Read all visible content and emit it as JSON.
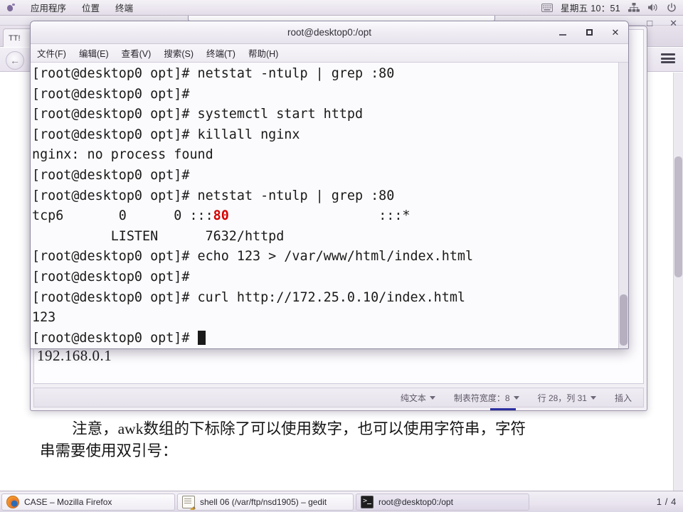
{
  "top_panel": {
    "menu": [
      {
        "label": "应用程序",
        "name": "applications-menu"
      },
      {
        "label": "位置",
        "name": "places-menu"
      },
      {
        "label": "终端",
        "name": "terminal-menu"
      }
    ],
    "clock": "星期五 10：51",
    "icons": [
      "keyboard-icon",
      "network-icon",
      "volume-icon",
      "power-icon"
    ]
  },
  "firefox": {
    "tab_label": "TT!",
    "url_value": "",
    "window_buttons": [
      "□",
      "✕"
    ]
  },
  "terminal": {
    "title": "root@desktop0:/opt",
    "menu": [
      {
        "label": "文件(F)",
        "name": "file-menu"
      },
      {
        "label": "编辑(E)",
        "name": "edit-menu"
      },
      {
        "label": "查看(V)",
        "name": "view-menu"
      },
      {
        "label": "搜索(S)",
        "name": "search-menu"
      },
      {
        "label": "终端(T)",
        "name": "terminal-menu"
      },
      {
        "label": "帮助(H)",
        "name": "help-menu"
      }
    ],
    "window_buttons": {
      "minimize": "－",
      "maximize": "□",
      "close": "✕"
    },
    "lines": [
      "[root@desktop0 opt]# netstat -ntulp | grep :80",
      "[root@desktop0 opt]#",
      "[root@desktop0 opt]# systemctl start httpd",
      "[root@desktop0 opt]# killall nginx",
      "nginx: no process found",
      "[root@desktop0 opt]#",
      "[root@desktop0 opt]# netstat -ntulp | grep :80",
      "tcp6       0      0 :::80                   :::*",
      "          LISTEN      7632/httpd",
      "[root@desktop0 opt]# echo 123 > /var/www/html/index.html",
      "[root@desktop0 opt]#",
      "[root@desktop0 opt]# curl http://172.25.0.10/index.html",
      "123",
      "[root@desktop0 opt]# "
    ],
    "netstat_row": {
      "proto": "tcp6",
      "recv_q": "0",
      "send_q": "0",
      "local_address_prefix": ":::",
      "local_address_port": "80",
      "foreign_address": ":::*",
      "state": "LISTEN",
      "pid_program": "7632/httpd"
    },
    "highlight_color": "#d40000",
    "prompt": "[root@desktop0 opt]#"
  },
  "gedit": {
    "document_text": "192.168.0.1",
    "statusbar": {
      "file_type": "纯文本",
      "tab_width": "制表符宽度：8",
      "position": "行 28，列 31",
      "insert_mode": "插入"
    }
  },
  "page_text": {
    "line1": "注意，awk数组的下标除了可以使用数字，也可以使用字符串，字符",
    "line2": "串需要使用双引号："
  },
  "taskbar": {
    "items": [
      {
        "label": "CASE – Mozilla Firefox",
        "icon": "firefox-icon",
        "name": "taskbar-item-firefox"
      },
      {
        "label": "shell 06 (/var/ftp/nsd1905) – gedit",
        "icon": "gedit-icon",
        "name": "taskbar-item-gedit"
      },
      {
        "label": "root@desktop0:/opt",
        "icon": "terminal-icon",
        "name": "taskbar-item-terminal"
      }
    ],
    "workspace": "1 / 4"
  }
}
